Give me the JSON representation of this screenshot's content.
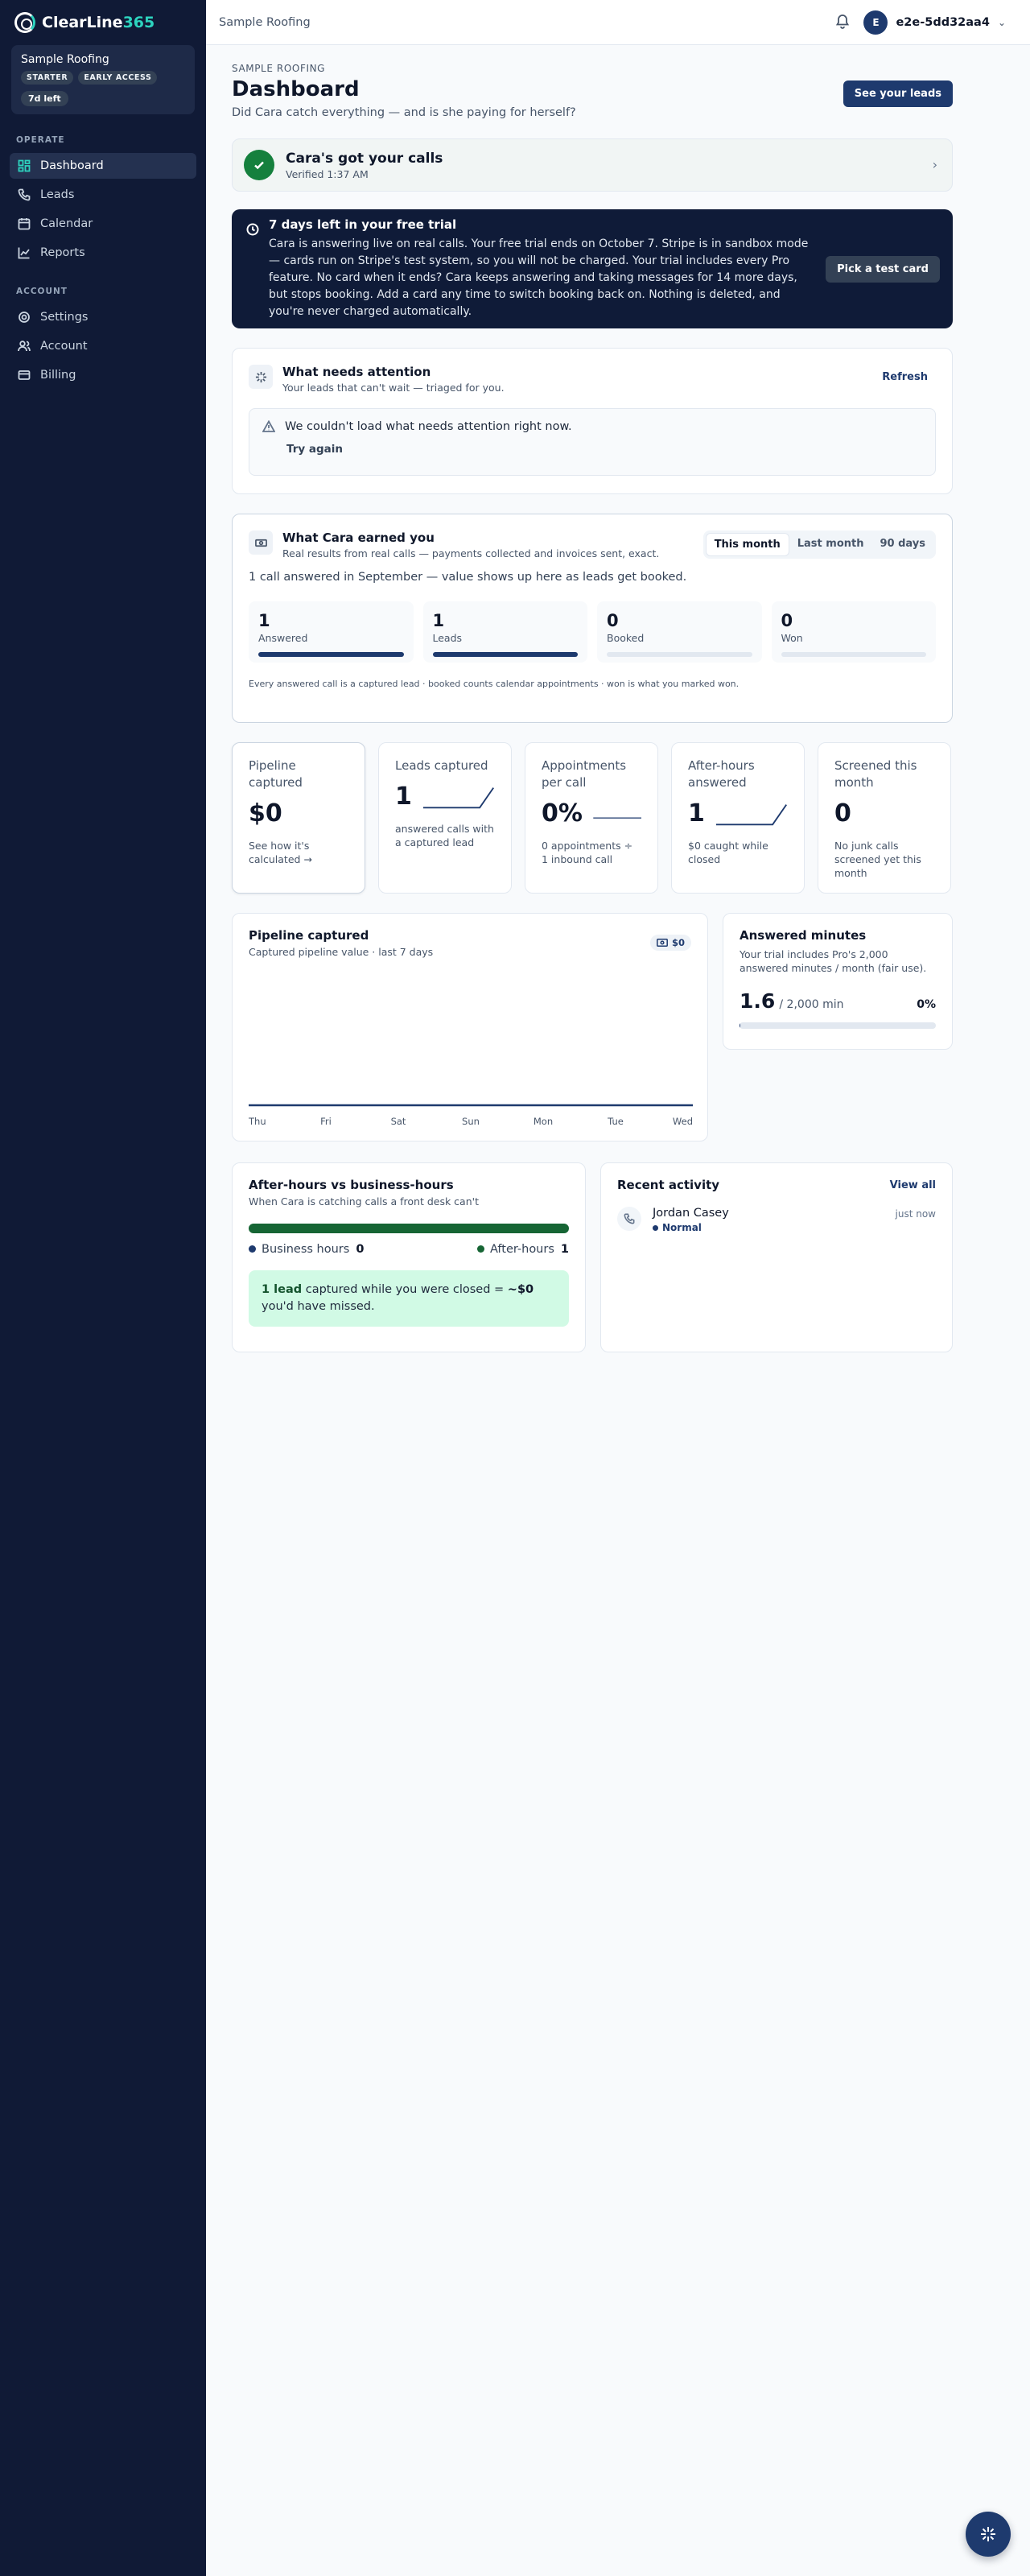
{
  "brand": {
    "name_main": "ClearLine",
    "name_accent": "365"
  },
  "org": {
    "name": "Sample Roofing",
    "badges": [
      "STARTER",
      "EARLY ACCESS"
    ],
    "time_left": "7d left"
  },
  "nav": {
    "operate_label": "OPERATE",
    "account_label": "ACCOUNT",
    "items": [
      "Dashboard",
      "Leads",
      "Calendar",
      "Reports"
    ],
    "account_items": [
      "Settings",
      "Account",
      "Billing"
    ]
  },
  "topbar": {
    "breadcrumb": "Sample Roofing",
    "avatar_initial": "E",
    "user_name": "e2e-5dd32aa4"
  },
  "page": {
    "eyebrow": "SAMPLE ROOFING",
    "title": "Dashboard",
    "subtitle": "Did Cara catch everything — and is she paying for herself?",
    "see_leads": "See your leads"
  },
  "verified": {
    "title": "Cara's got your calls",
    "sub": "Verified 1:37 AM"
  },
  "trial": {
    "title": "7 days left in your free trial",
    "text": "Cara is answering live on real calls. Your free trial ends on October 7. Stripe is in sandbox mode — cards run on Stripe's test system, so you will not be charged. Your trial includes every Pro feature. No card when it ends? Cara keeps answering and taking messages for 14 more days, but stops booking. Add a card any time to switch booking back on. Nothing is deleted, and you're never charged automatically.",
    "button": "Pick a test card"
  },
  "attention": {
    "title": "What needs attention",
    "sub": "Your leads that can't wait — triaged for you.",
    "refresh": "Refresh",
    "error": "We couldn't load what needs attention right now.",
    "try_again": "Try again"
  },
  "earned": {
    "title": "What Cara earned you",
    "sub": "Real results from real calls — payments collected and invoices sent, exact.",
    "ranges": [
      "This month",
      "Last month",
      "90 days"
    ],
    "summary": "1 call answered in September — value shows up here as leads get booked.",
    "tiles": [
      {
        "value": "1",
        "label": "Answered",
        "fill": 1
      },
      {
        "value": "1",
        "label": "Leads",
        "fill": 1
      },
      {
        "value": "0",
        "label": "Booked",
        "fill": 0
      },
      {
        "value": "0",
        "label": "Won",
        "fill": 0
      }
    ],
    "footnote": "Every answered call is a captured lead · booked counts calendar appointments · won is what you marked won."
  },
  "kpis": [
    {
      "label": "Pipeline captured",
      "value": "$0",
      "note": "See how it's calculated →"
    },
    {
      "label": "Leads captured",
      "value": "1",
      "note": "answered calls with a captured lead"
    },
    {
      "label": "Appointments per call",
      "value": "0%",
      "note": "0 appointments ÷ 1 inbound call"
    },
    {
      "label": "After-hours answered",
      "value": "1",
      "note": "$0 caught while closed"
    },
    {
      "label": "Screened this month",
      "value": "0",
      "note": "No junk calls screened yet this month"
    }
  ],
  "pipeline": {
    "title": "Pipeline captured",
    "sub": "Captured pipeline value · last 7 days",
    "chip": "$0"
  },
  "chart_data": {
    "type": "line",
    "categories": [
      "Thu",
      "Fri",
      "Sat",
      "Sun",
      "Mon",
      "Tue",
      "Wed"
    ],
    "values": [
      0,
      0,
      0,
      0,
      0,
      0,
      0
    ],
    "title": "Pipeline captured",
    "xlabel": "",
    "ylabel": "",
    "grid": false,
    "color": "#1e3a6e"
  },
  "minutes": {
    "title": "Answered minutes",
    "sub": "Your trial includes Pro's 2,000 answered minutes / month (fair use).",
    "used": "1.6",
    "total": "/ 2,000 min",
    "percent": "0%",
    "fill": 0.0008
  },
  "afterhours": {
    "title": "After-hours vs business-hours",
    "sub": "When Cara is catching calls a front desk can't",
    "business_label": "Business hours",
    "business_count": "0",
    "after_label": "After-hours",
    "after_count": "1",
    "business_share": 0,
    "missed_lead": "1 lead",
    "missed_text": "captured while you were closed =",
    "missed_amount": "~$0",
    "missed_tail": "you'd have missed.",
    "colors": {
      "business": "#1e3a6e",
      "after": "#166534"
    }
  },
  "activity": {
    "title": "Recent activity",
    "view_all": "View all",
    "items": [
      {
        "name": "Jordan Casey",
        "priority": "Normal",
        "time": "just now"
      }
    ]
  }
}
